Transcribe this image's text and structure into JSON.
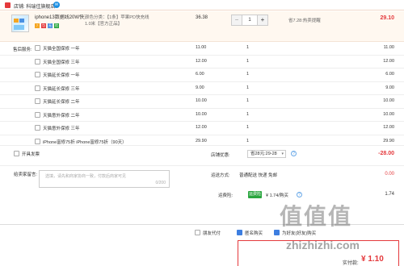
{
  "shop": {
    "name": "店铺: 科瑞佳旗舰店",
    "ww_icon": "wangwang-chat-icon"
  },
  "item": {
    "title_line1": "iphone13数据线20W快充PD手...",
    "badges": [
      "7",
      "包",
      "无",
      "险"
    ],
    "attr_line1": "颜色分类：【1条】苹果PD快充线",
    "attr_line2": "1.0米【官方正品】",
    "price": "36.38",
    "quantity": "1",
    "minus": "−",
    "plus": "+",
    "saved": "省7.28:热卖提醒",
    "subtotal": "29.10"
  },
  "services": {
    "label": "售后服务:",
    "rows": [
      {
        "name": "天猫全国保修 一年",
        "price": "11.00",
        "qty": "1",
        "total": "11.00"
      },
      {
        "name": "天猫全国保修 三年",
        "price": "12.00",
        "qty": "1",
        "total": "12.00"
      },
      {
        "name": "天猫延长保修 一年",
        "price": "6.00",
        "qty": "1",
        "total": "6.00"
      },
      {
        "name": "天猫延长保修 三年",
        "price": "9.00",
        "qty": "1",
        "total": "9.00"
      },
      {
        "name": "天猫延长保修 二年",
        "price": "10.00",
        "qty": "1",
        "total": "10.00"
      },
      {
        "name": "天猫意外保修 二年",
        "price": "10.00",
        "qty": "1",
        "total": "10.00"
      },
      {
        "name": "天猫意外保修 三年",
        "price": "12.00",
        "qty": "1",
        "total": "12.00"
      },
      {
        "name": "iPhone富修75折 iPhone富修75折（90天）",
        "price": "29.90",
        "qty": "1",
        "total": "29.90"
      }
    ]
  },
  "invoice": {
    "label": "开具发票"
  },
  "discount": {
    "label": "店铺优惠:",
    "select": "省28元:29-28",
    "value": "-28.00"
  },
  "message": {
    "label": "给卖家留言:",
    "placeholder": "选填，请先和商家协商一致，付款后商家可见",
    "count": "0/200"
  },
  "shipping": {
    "label": "运送方式:",
    "select": "普通配送 快递 免邮",
    "value": "0.00"
  },
  "insurance": {
    "label": "运费险:",
    "tag": "运费险",
    "text": "¥ 1.74/购买",
    "value": "1.74"
  },
  "footer": {
    "options": [
      {
        "label": "朋友代付",
        "checked": false
      },
      {
        "label": "匿名购买",
        "checked": true
      },
      {
        "label": "为好友(好友)购买",
        "checked": true
      }
    ],
    "pay_label": "实付款:",
    "pay_value": "¥ 1.10"
  },
  "watermark": {
    "logo": "值值值",
    "url": "zhizhizhi.com"
  },
  "colors": {
    "accent": "#e4393c",
    "item_bg": "#fff8f0",
    "link": "#1a8fe3",
    "green": "#2aa63f"
  }
}
